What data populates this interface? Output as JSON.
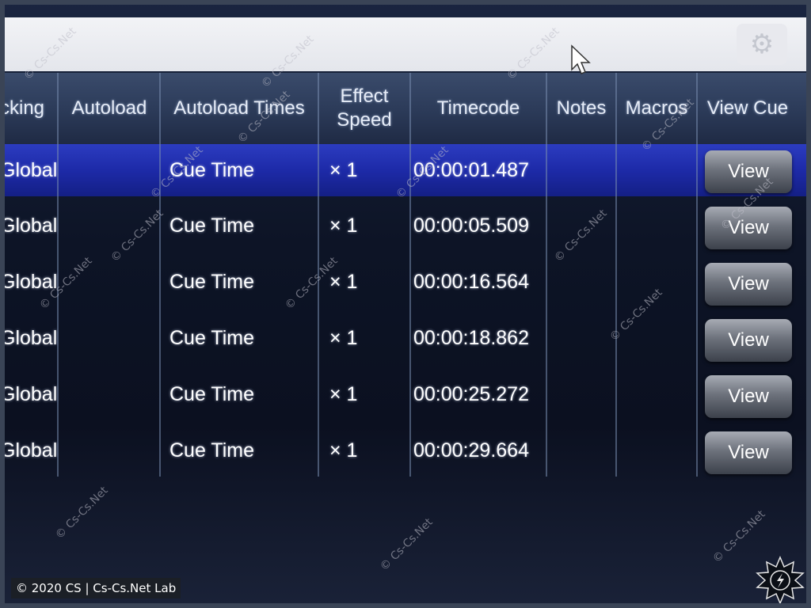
{
  "header": {
    "columns": [
      "cking",
      "Autoload",
      "Autoload Times",
      "Effect Speed",
      "Timecode",
      "Notes",
      "Macros",
      "View Cue"
    ]
  },
  "rows": [
    {
      "tracking": "Global",
      "autoload": "",
      "autoload_times": "Cue Time",
      "effect_speed": "× 1",
      "timecode": "00:00:01.487",
      "notes": "",
      "macros": "",
      "view": "View",
      "selected": true
    },
    {
      "tracking": "Global",
      "autoload": "",
      "autoload_times": "Cue Time",
      "effect_speed": "× 1",
      "timecode": "00:00:05.509",
      "notes": "",
      "macros": "",
      "view": "View",
      "selected": false
    },
    {
      "tracking": "Global",
      "autoload": "",
      "autoload_times": "Cue Time",
      "effect_speed": "× 1",
      "timecode": "00:00:16.564",
      "notes": "",
      "macros": "",
      "view": "View",
      "selected": false
    },
    {
      "tracking": "Global",
      "autoload": "",
      "autoload_times": "Cue Time",
      "effect_speed": "× 1",
      "timecode": "00:00:18.862",
      "notes": "",
      "macros": "",
      "view": "View",
      "selected": false
    },
    {
      "tracking": "Global",
      "autoload": "",
      "autoload_times": "Cue Time",
      "effect_speed": "× 1",
      "timecode": "00:00:25.272",
      "notes": "",
      "macros": "",
      "view": "View",
      "selected": false
    },
    {
      "tracking": "Global",
      "autoload": "",
      "autoload_times": "Cue Time",
      "effect_speed": "× 1",
      "timecode": "00:00:29.664",
      "notes": "",
      "macros": "",
      "view": "View",
      "selected": false
    }
  ],
  "icons": {
    "settings": "gear-icon",
    "cursor": "mouse-cursor-icon",
    "logo": "lightning-star-logo"
  },
  "watermark": "© Cs-Cs.Net",
  "footer": {
    "text": "© 2020 CS | Cs-Cs.Net Lab"
  },
  "colors": {
    "selected_row": "#1d2aa8",
    "header": "#2b3a58",
    "topbar": "#eceef2",
    "button": "#6d727c"
  }
}
